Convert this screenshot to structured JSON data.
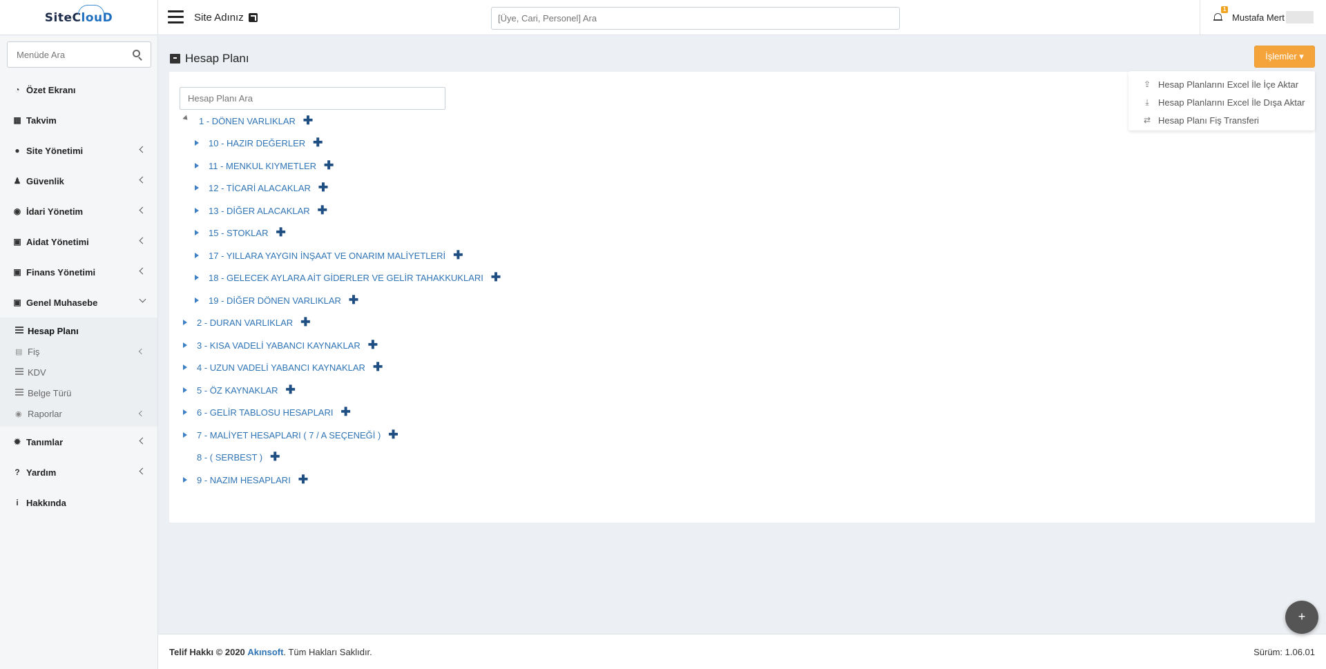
{
  "header": {
    "logo": {
      "left": "SiteC",
      "mid": "l",
      "right": "ouD"
    },
    "site_name": "Site Adınız",
    "search_placeholder": "[Üye, Cari, Personel] Ara",
    "notification_count": "1",
    "user_name": "Mustafa Mert"
  },
  "sidebar": {
    "search_placeholder": "Menüde Ara",
    "items": [
      {
        "label": "Özet Ekranı",
        "icon": "dashboard-icon"
      },
      {
        "label": "Takvim",
        "icon": "calendar-icon"
      },
      {
        "label": "Site Yönetimi",
        "icon": "users-icon"
      },
      {
        "label": "Güvenlik",
        "icon": "user-secret-icon"
      },
      {
        "label": "İdari Yönetim",
        "icon": "globe-icon"
      },
      {
        "label": "Aidat Yönetimi",
        "icon": "money-icon"
      },
      {
        "label": "Finans Yönetimi",
        "icon": "money-icon"
      },
      {
        "label": "Genel Muhasebe",
        "icon": "money-icon"
      },
      {
        "label": "Tanımlar",
        "icon": "gear-icon"
      },
      {
        "label": "Yardım",
        "icon": "question-icon"
      },
      {
        "label": "Hakkında",
        "icon": "info-icon"
      }
    ],
    "submenu": [
      {
        "label": "Hesap Planı"
      },
      {
        "label": "Fiş"
      },
      {
        "label": "KDV"
      },
      {
        "label": "Belge Türü"
      },
      {
        "label": "Raporlar"
      }
    ]
  },
  "main": {
    "title": "Hesap Planı",
    "actions_label": "İşlemler",
    "dropdown": [
      {
        "label": "Hesap Planlarını Excel İle İçe Aktar",
        "icon": "upload-icon"
      },
      {
        "label": "Hesap Planlarını Excel İle Dışa Aktar",
        "icon": "download-icon"
      },
      {
        "label": "Hesap Planı Fiş Transferi",
        "icon": "exchange-icon"
      }
    ],
    "tree_search_placeholder": "Hesap Planı Ara",
    "tree": [
      {
        "label": "1 - DÖNEN VARLIKLAR"
      },
      {
        "label": "10 - HAZIR DEĞERLER"
      },
      {
        "label": "11 - MENKUL KIYMETLER"
      },
      {
        "label": "12 - TİCARİ ALACAKLAR"
      },
      {
        "label": "13 - DİĞER ALACAKLAR"
      },
      {
        "label": "15 - STOKLAR"
      },
      {
        "label": "17 - YILLARA YAYGIN İNŞAAT VE ONARIM MALİYETLERİ"
      },
      {
        "label": "18 - GELECEK AYLARA AİT GİDERLER VE GELİR TAHAKKUKLARI"
      },
      {
        "label": "19 - DİĞER DÖNEN VARLIKLAR"
      },
      {
        "label": "2 - DURAN VARLIKLAR"
      },
      {
        "label": "3 - KISA VADELİ YABANCI KAYNAKLAR"
      },
      {
        "label": "4 - UZUN VADELİ YABANCI KAYNAKLAR"
      },
      {
        "label": "5 - ÖZ KAYNAKLAR"
      },
      {
        "label": "6 - GELİR TABLOSU HESAPLARI"
      },
      {
        "label": "7 - MALİYET HESAPLARI ( 7 / A SEÇENEĞİ )"
      },
      {
        "label": "8 - ( SERBEST )"
      },
      {
        "label": "9 - NAZIM HESAPLARI"
      }
    ]
  },
  "footer": {
    "copyright_prefix": "Telif Hakkı © 2020",
    "brand": "Akınsoft",
    "suffix": ". Tüm Hakları Saklıdır.",
    "version": "Sürüm: 1.06.01"
  },
  "fab_label": "+",
  "colors": {
    "accent": "#f4a43a",
    "link": "#2f74b5",
    "plus": "#1f4f82"
  }
}
